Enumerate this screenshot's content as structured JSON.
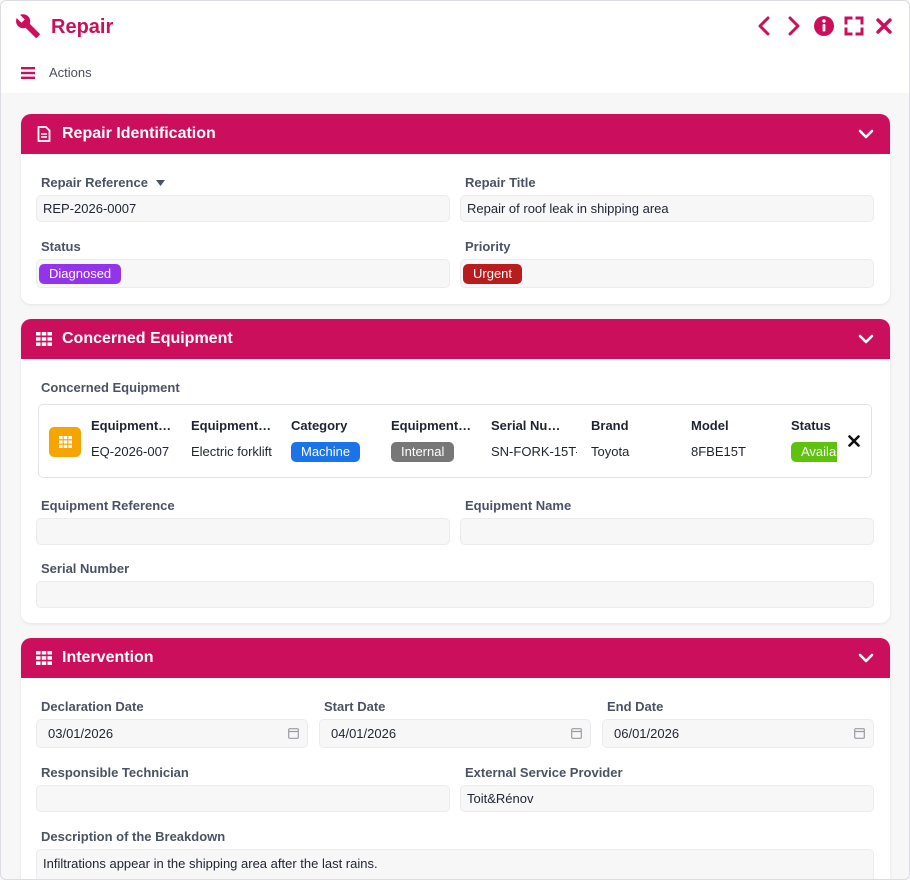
{
  "app": {
    "title": "Repair",
    "actions_label": "Actions"
  },
  "colors": {
    "accent": "#cc0f5c"
  },
  "sections": {
    "identification": {
      "title": "Repair Identification",
      "fields": {
        "reference": {
          "label": "Repair Reference",
          "value": "REP-2026-0007"
        },
        "title": {
          "label": "Repair Title",
          "value": "Repair of roof leak in shipping area"
        },
        "status": {
          "label": "Status",
          "value": "Diagnosed",
          "color": "#9333ea"
        },
        "priority": {
          "label": "Priority",
          "value": "Urgent",
          "color": "#b91c1c"
        }
      }
    },
    "equipment": {
      "title": "Concerned Equipment",
      "list_label": "Concerned Equipment",
      "columns": [
        "Equipment…",
        "Equipment…",
        "Category",
        "Equipment…",
        "Serial Nu…",
        "Brand",
        "Model",
        "Status"
      ],
      "row": {
        "ref": "EQ-2026-007",
        "name": "Electric forklift",
        "category": "Machine",
        "ownership": "Internal",
        "serial": "SN-FORK-15T-",
        "brand": "Toyota",
        "model": "8FBE15T",
        "status": "Available"
      },
      "badge_colors": {
        "category": "#1a73e8",
        "ownership": "#777777",
        "status": "#5ec20f"
      },
      "fields": {
        "eq_reference": {
          "label": "Equipment Reference",
          "value": ""
        },
        "eq_name": {
          "label": "Equipment Name",
          "value": ""
        },
        "serial": {
          "label": "Serial Number",
          "value": ""
        }
      }
    },
    "intervention": {
      "title": "Intervention",
      "fields": {
        "declaration": {
          "label": "Declaration Date",
          "value": "03/01/2026"
        },
        "start": {
          "label": "Start Date",
          "value": "04/01/2026"
        },
        "end": {
          "label": "End Date",
          "value": "06/01/2026"
        },
        "technician": {
          "label": "Responsible Technician",
          "value": ""
        },
        "provider": {
          "label": "External Service Provider",
          "value": "Toit&Rénov"
        },
        "description": {
          "label": "Description of the Breakdown",
          "value": "Infiltrations appear in the shipping area after the last rains."
        }
      }
    }
  }
}
